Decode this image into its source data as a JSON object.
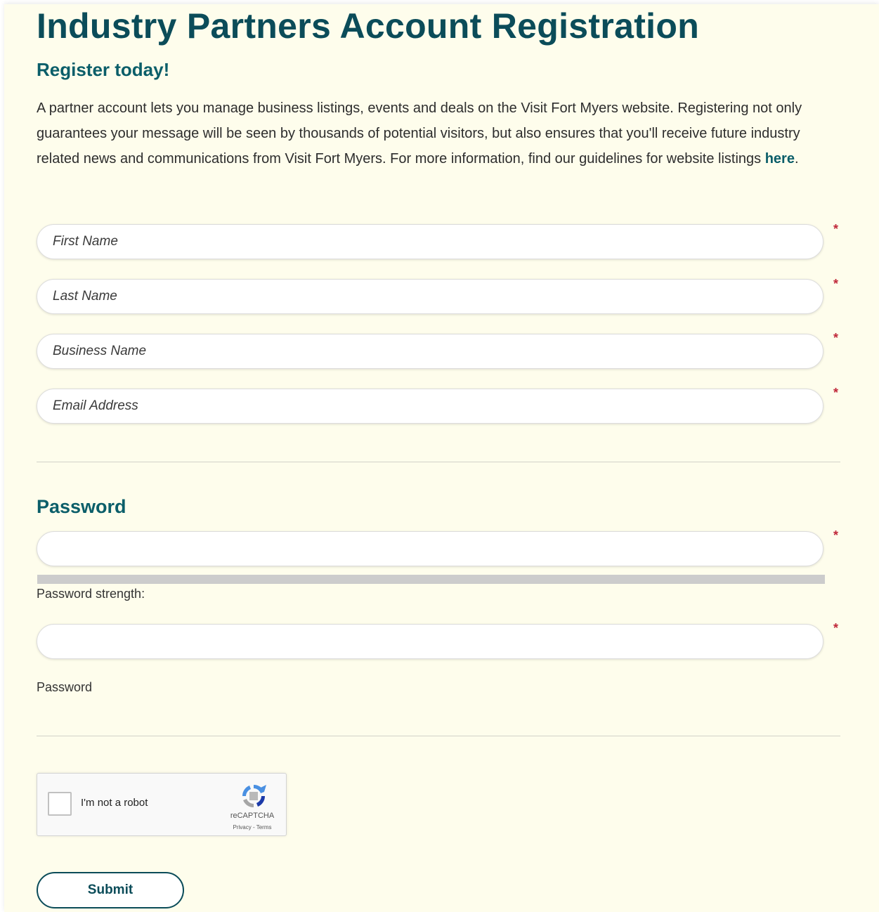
{
  "page": {
    "title": "Industry Partners Account Registration",
    "subtitle": "Register today!",
    "intro_text": "A partner account lets you manage business listings, events and deals on the Visit Fort Myers website. Registering not only guarantees your message will be seen by thousands of potential visitors, but also ensures that you'll receive future industry related news and communications from Visit Fort Myers. For more information, find our guidelines for website listings ",
    "intro_link": "here",
    "intro_end": "."
  },
  "form": {
    "required_marker": "*",
    "first_name": {
      "placeholder": "First Name",
      "value": ""
    },
    "last_name": {
      "placeholder": "Last Name",
      "value": ""
    },
    "business_name": {
      "placeholder": "Business Name",
      "value": ""
    },
    "email": {
      "placeholder": "Email Address",
      "value": ""
    },
    "password_section_title": "Password",
    "password": {
      "placeholder": "",
      "value": ""
    },
    "password_strength_label": "Password strength:",
    "password_strength_level": 0,
    "confirm_password": {
      "placeholder": "",
      "value": ""
    },
    "confirm_password_label": "Password",
    "captcha": {
      "label": "I'm not a robot",
      "brand": "reCAPTCHA",
      "links": "Privacy - Terms",
      "checked": false
    },
    "submit_label": "Submit"
  },
  "colors": {
    "background": "#fefdec",
    "heading": "#0b4c59",
    "accent": "#0b5e69",
    "required": "#c0283a"
  },
  "icons": {
    "captcha_logo": "recaptcha-icon"
  }
}
